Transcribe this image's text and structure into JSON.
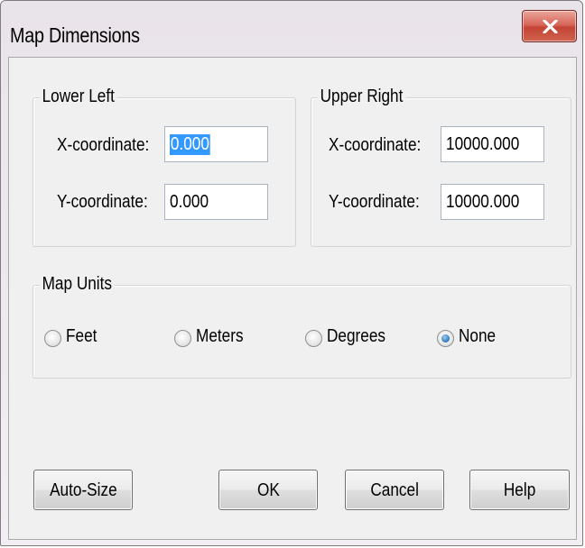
{
  "window": {
    "title": "Map Dimensions"
  },
  "lower_left": {
    "title": "Lower Left",
    "x_label": "X-coordinate:",
    "x_value": "0.000",
    "y_label": "Y-coordinate:",
    "y_value": "0.000"
  },
  "upper_right": {
    "title": "Upper Right",
    "x_label": "X-coordinate:",
    "x_value": "10000.000",
    "y_label": "Y-coordinate:",
    "y_value": "10000.000"
  },
  "map_units": {
    "title": "Map Units",
    "options": [
      {
        "label": "Feet",
        "selected": false
      },
      {
        "label": "Meters",
        "selected": false
      },
      {
        "label": "Degrees",
        "selected": false
      },
      {
        "label": "None",
        "selected": true
      }
    ]
  },
  "buttons": {
    "auto_size": "Auto-Size",
    "ok": "OK",
    "cancel": "Cancel",
    "help": "Help"
  }
}
